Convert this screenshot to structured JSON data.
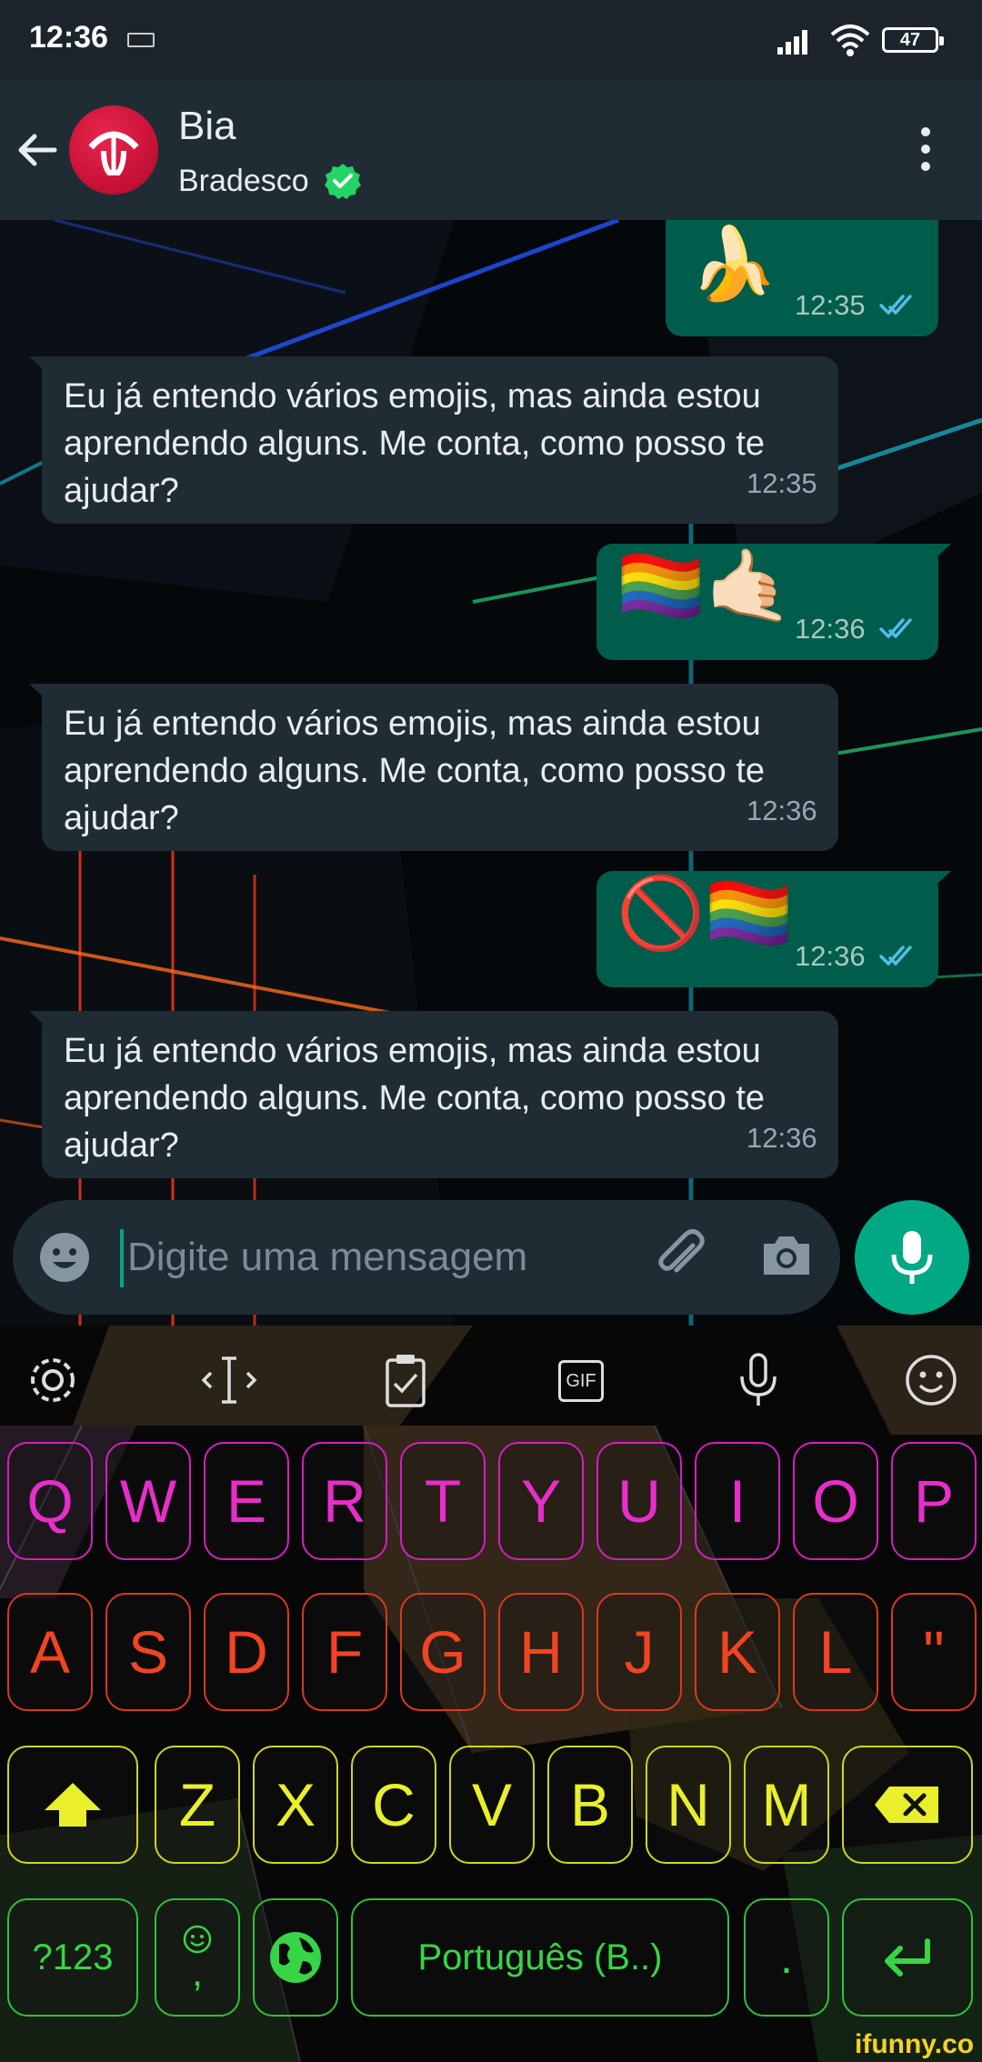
{
  "status_bar": {
    "time": "12:36",
    "battery": "47"
  },
  "header": {
    "name": "Bia",
    "subtitle": "Bradesco"
  },
  "messages": [
    {
      "direction": "out",
      "emoji": "🍌",
      "time": "12:35"
    },
    {
      "direction": "in",
      "text": "Eu já entendo vários emojis, mas ainda estou aprendendo alguns. Me conta, como posso te ajudar?",
      "time": "12:35"
    },
    {
      "direction": "out",
      "emoji": "🏳️‍🌈🤙🏻",
      "time": "12:36"
    },
    {
      "direction": "in",
      "text": "Eu já entendo vários emojis, mas ainda estou aprendendo alguns. Me conta, como posso te ajudar?",
      "time": "12:36"
    },
    {
      "direction": "out",
      "emoji": "🚫🏳️‍🌈",
      "time": "12:36"
    },
    {
      "direction": "in",
      "text": "Eu já entendo vários emojis, mas ainda estou aprendendo alguns. Me conta, como posso te ajudar?",
      "time": "12:36"
    }
  ],
  "composer": {
    "placeholder": "Digite uma mensagem"
  },
  "keyboard": {
    "toolbar": [
      "settings-icon",
      "cursor-move-icon",
      "clipboard-icon",
      "gif-icon",
      "voice-input-icon",
      "emoji-icon"
    ],
    "gif_label": "GIF",
    "row1": [
      "Q",
      "W",
      "E",
      "R",
      "T",
      "Y",
      "U",
      "I",
      "O",
      "P"
    ],
    "row2": [
      "A",
      "S",
      "D",
      "F",
      "G",
      "H",
      "J",
      "K",
      "L",
      "\""
    ],
    "row3": [
      "Z",
      "X",
      "C",
      "V",
      "B",
      "N",
      "M"
    ],
    "row4": {
      "symbols": "?123",
      "comma": ",",
      "space": "Português (B..)",
      "period": "."
    }
  },
  "watermark": "ifunny.co",
  "colors": {
    "accent": "#00a884",
    "outgoing_bubble": "#005c4b",
    "incoming_bubble": "#1f2c34",
    "read_ticks": "#53bdeb",
    "row1": "#e72ec9",
    "row2": "#f14422",
    "row3": "#e9ef2b",
    "row4": "#37d447"
  }
}
